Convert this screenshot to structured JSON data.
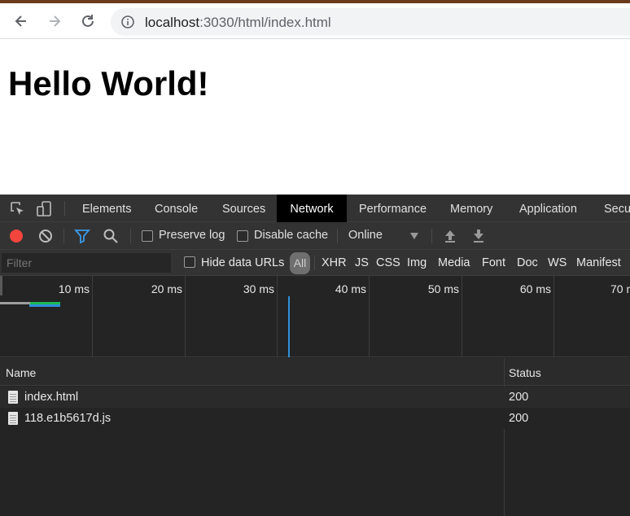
{
  "browser": {
    "url_host": "localhost",
    "url_rest": ":3030/html/index.html",
    "icons": {
      "back": "arrow-left-icon",
      "forward": "arrow-right-icon",
      "reload": "reload-icon",
      "info": "info-icon"
    }
  },
  "page": {
    "heading": "Hello World!"
  },
  "devtools": {
    "tabs": [
      "Elements",
      "Console",
      "Sources",
      "Network",
      "Performance",
      "Memory",
      "Application",
      "Secu"
    ],
    "active_tab": "Network",
    "toolbar": {
      "preserve_log": "Preserve log",
      "disable_cache": "Disable cache",
      "throttle": "Online"
    },
    "filter": {
      "placeholder": "Filter",
      "hide_data_urls": "Hide data URLs",
      "all": "All",
      "types": [
        "XHR",
        "JS",
        "CSS",
        "Img",
        "Media",
        "Font",
        "Doc",
        "WS",
        "Manifest"
      ]
    },
    "overview": {
      "ticks": [
        "10 ms",
        "20 ms",
        "30 ms",
        "40 ms",
        "50 ms",
        "60 ms",
        "70 m"
      ]
    },
    "table": {
      "headers": {
        "name": "Name",
        "status": "Status"
      },
      "rows": [
        {
          "name": "index.html",
          "status": "200"
        },
        {
          "name": "118.e1b5617d.js",
          "status": "200"
        }
      ]
    },
    "colors": {
      "record": "#f2453d",
      "dom_content_loaded": "#2f8fd8",
      "accent_bar": "#1db954"
    }
  }
}
